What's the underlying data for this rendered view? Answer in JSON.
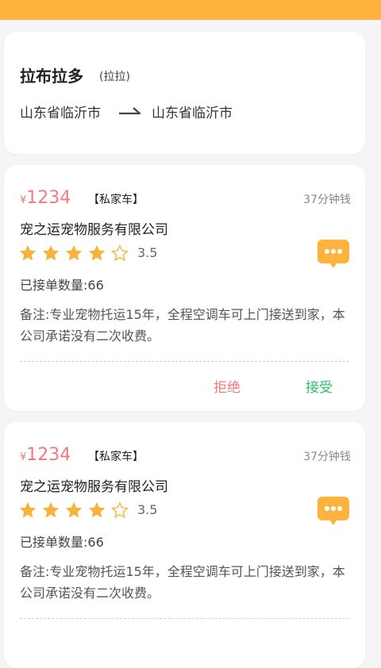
{
  "colors": {
    "header_bar": "#ffb33c",
    "price": "#f47a7a",
    "star": "#f7b23b",
    "reject": "#f47a7a",
    "accept": "#2dbd64"
  },
  "route": {
    "pet_name": "拉布拉多",
    "pet_nickname": "(拉拉)",
    "from": "山东省临沂市",
    "to": "山东省临沂市",
    "arrow_icon": "route-arrow-icon"
  },
  "offers": [
    {
      "currency": "¥",
      "price": "1234",
      "car_type": "【私家车】",
      "time_ago": "37分钟钱",
      "company": "宠之运宠物服务有限公司",
      "stars_filled": 4,
      "stars_total": 5,
      "rating": "3.5",
      "orders_label": "已接单数量:",
      "orders_count": "66",
      "remark": "备注:专业宠物托运15年，全程空调车可上门接送到家，本公司承诺没有二次收费。",
      "chat_icon": "chat-bubble-icon",
      "reject_label": "拒绝",
      "accept_label": "接受"
    },
    {
      "currency": "¥",
      "price": "1234",
      "car_type": "【私家车】",
      "time_ago": "37分钟钱",
      "company": "宠之运宠物服务有限公司",
      "stars_filled": 4,
      "stars_total": 5,
      "rating": "3.5",
      "orders_label": "已接单数量:",
      "orders_count": "66",
      "remark": "备注:专业宠物托运15年，全程空调车可上门接送到家，本公司承诺没有二次收费。",
      "chat_icon": "chat-bubble-icon"
    }
  ]
}
